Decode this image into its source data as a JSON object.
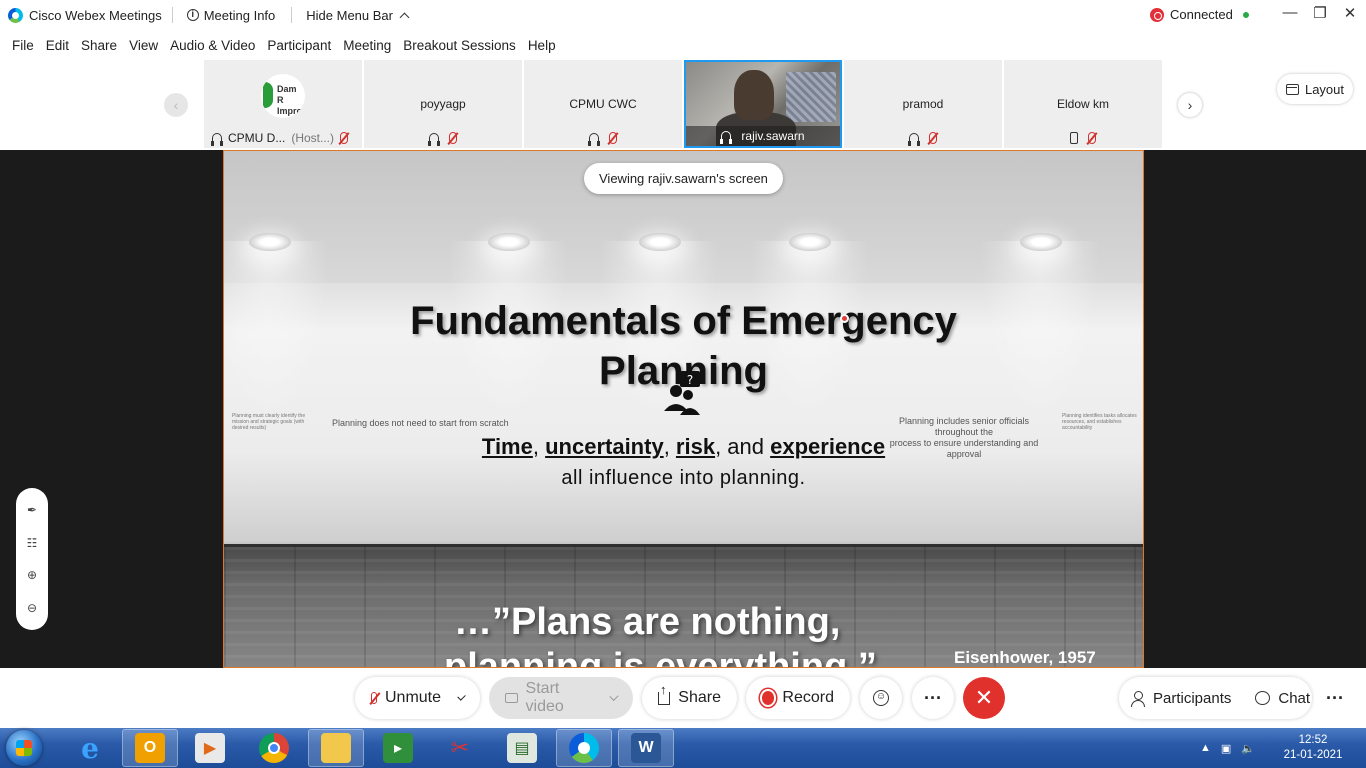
{
  "titlebar": {
    "app_name": "Cisco Webex Meetings",
    "meeting_info": "Meeting Info",
    "hide_menu": "Hide Menu Bar",
    "connection": "Connected"
  },
  "menu": [
    "File",
    "Edit",
    "Share",
    "View",
    "Audio & Video",
    "Participant",
    "Meeting",
    "Breakout Sessions",
    "Help"
  ],
  "participants": [
    {
      "name": "CPMU D...",
      "role": "(Host...)",
      "logo_text": "Dam R Improv"
    },
    {
      "name": "poyyagp"
    },
    {
      "name": "CPMU CWC"
    },
    {
      "name": "rajiv.sawarn"
    },
    {
      "name": "pramod"
    },
    {
      "name": "Eldow km"
    }
  ],
  "layout_label": "Layout",
  "stage": {
    "viewing": "Viewing rajiv.sawarn's screen",
    "slide": {
      "title_line1": "Fundamentals of Emergency",
      "title_line2": "Planning",
      "sub_time": "Time",
      "sub_uncertainty": "uncertainty",
      "sub_risk": "risk",
      "sub_and": ", and ",
      "sub_experience": "experience",
      "sub_line2": "all influence into planning.",
      "note_left": "Planning does not need to start from scratch",
      "note_right_1": "Planning includes senior officials throughout the",
      "note_right_2": "process to ensure understanding and approval",
      "tiny_left": "Planning must clearly identify the mission and strategic goals (with desired results)",
      "tiny_right": "Planning identifies tasks allocates resources, and establishes accountability",
      "quote_line1": "…”Plans are nothing,",
      "quote_line2": "planning is everything.”",
      "attribution": "Eisenhower, 1957"
    }
  },
  "controls": {
    "unmute": "Unmute",
    "start_video": "Start video",
    "share": "Share",
    "record": "Record",
    "more": "···",
    "participants": "Participants",
    "chat": "Chat"
  },
  "taskbar": {
    "time": "12:52",
    "date": "21-01-2021"
  }
}
